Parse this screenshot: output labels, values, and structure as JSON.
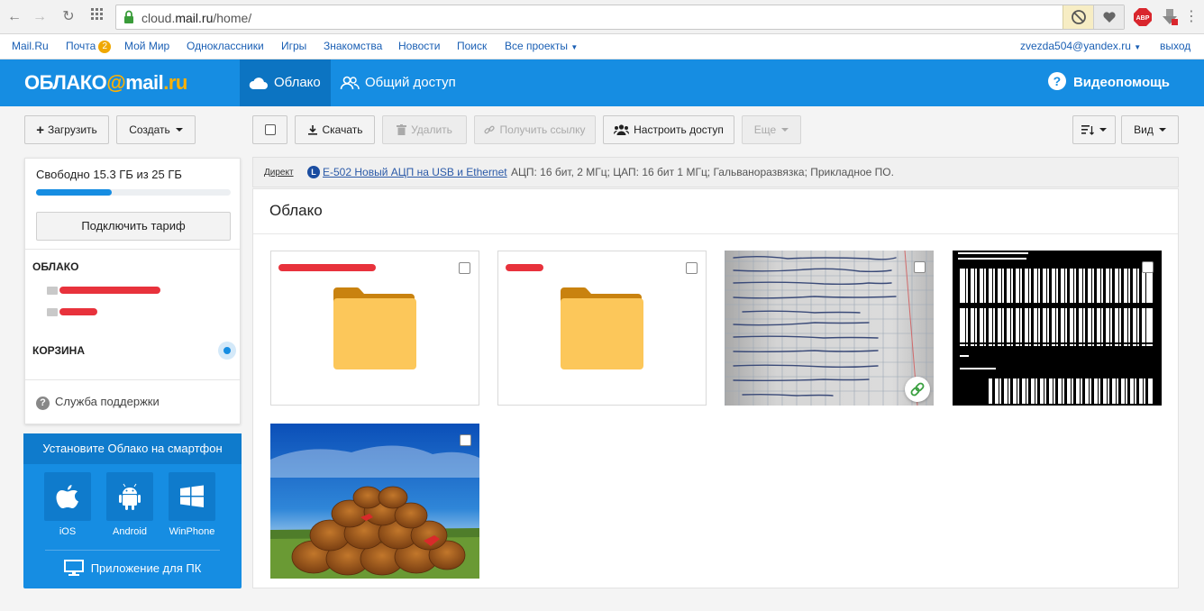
{
  "browser": {
    "url_prefix": "cloud.",
    "url_domain": "mail.ru",
    "url_path": "/home/"
  },
  "portal": {
    "links": [
      "Mail.Ru",
      "Почта",
      "Мой Мир",
      "Одноклассники",
      "Игры",
      "Знакомства",
      "Новости",
      "Поиск",
      "Все проекты"
    ],
    "mail_count": "2",
    "user": "zvezda504@yandex.ru",
    "logout": "выход"
  },
  "header": {
    "logo_left": "ОБЛАКО",
    "logo_at": "@",
    "logo_mail": "mail",
    "logo_ru": ".ru",
    "tab_cloud": "Облако",
    "tab_shared": "Общий доступ",
    "help": "Видеопомощь"
  },
  "toolbar": {
    "upload": "Загрузить",
    "create": "Создать",
    "download": "Скачать",
    "delete": "Удалить",
    "get_link": "Получить ссылку",
    "access": "Настроить доступ",
    "more": "Еще",
    "view": "Вид"
  },
  "sidebar": {
    "quota": "Свободно 15.3 ГБ из 25 ГБ",
    "quota_used_fraction": 0.388,
    "tariff": "Подключить тариф",
    "cloud_title": "ОБЛАКО",
    "trash_title": "КОРЗИНА",
    "support": "Служба поддержки"
  },
  "promo": {
    "title": "Установите Облако на смартфон",
    "ios": "iOS",
    "android": "Android",
    "winphone": "WinPhone",
    "pc": "Приложение для ПК"
  },
  "ad": {
    "label": "Директ",
    "link": "E-502 Новый АЦП на USB и Ethernet",
    "desc": "АЦП: 16 бит, 2 МГц; ЦАП: 16 бит 1 МГц; Гальваноразвязка; Прикладное ПО."
  },
  "content": {
    "title": "Облако"
  },
  "colors": {
    "brand_blue": "#168de2",
    "brand_dark": "#0c74c2",
    "folder": "#fcc75a",
    "folder_tab": "#c9820f",
    "redaction": "#e8323c"
  }
}
